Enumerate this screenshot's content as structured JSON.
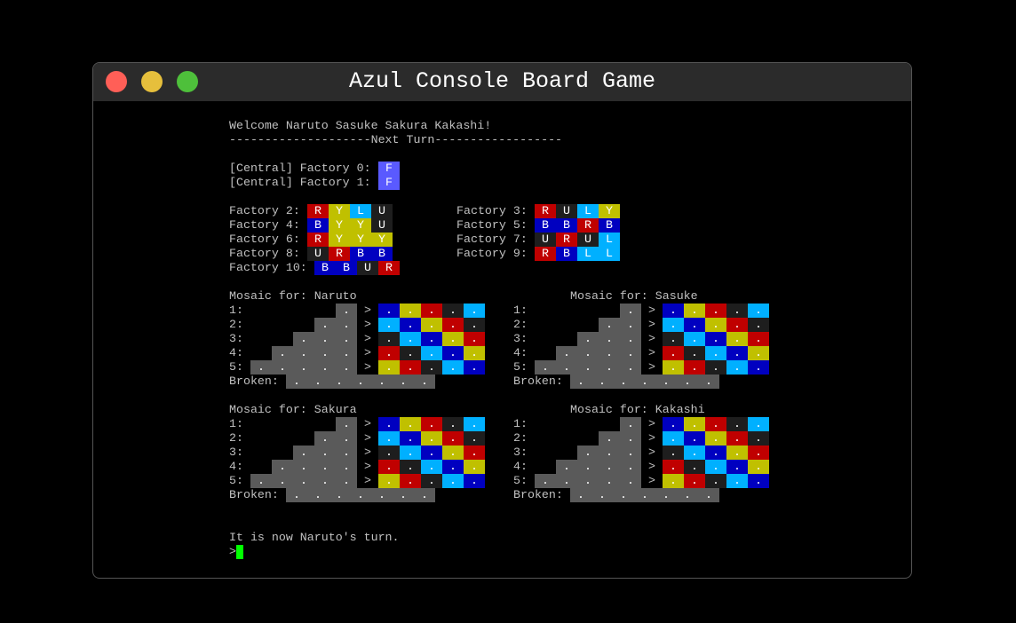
{
  "window": {
    "title": "Azul Console Board Game"
  },
  "colors": {
    "R": "#c00000",
    "Y": "#c0c000",
    "L": "#00b0ff",
    "U": "#1e1e1e",
    "B": "#0000c0",
    "F": "#5a5aff",
    "slot": "#5a5a5a",
    "cursor": "#00ff00"
  },
  "welcome": "Welcome Naruto Sasuke Sakura Kakashi!",
  "separator": "--------------------Next Turn------------------",
  "central": [
    {
      "label": "[Central] Factory 0: ",
      "tiles": [
        "F"
      ]
    },
    {
      "label": "[Central] Factory 1: ",
      "tiles": [
        "F"
      ]
    }
  ],
  "factories_left": [
    {
      "label": "Factory 2: ",
      "tiles": [
        "R",
        "Y",
        "L",
        "U"
      ]
    },
    {
      "label": "Factory 4: ",
      "tiles": [
        "B",
        "Y",
        "Y",
        "U"
      ]
    },
    {
      "label": "Factory 6: ",
      "tiles": [
        "R",
        "Y",
        "Y",
        "Y"
      ]
    },
    {
      "label": "Factory 8: ",
      "tiles": [
        "U",
        "R",
        "B",
        "B"
      ]
    },
    {
      "label": "Factory 10: ",
      "tiles": [
        "B",
        "B",
        "U",
        "R"
      ]
    }
  ],
  "factories_right": [
    {
      "label": "Factory 3: ",
      "tiles": [
        "R",
        "U",
        "L",
        "Y"
      ]
    },
    {
      "label": "Factory 5: ",
      "tiles": [
        "B",
        "B",
        "R",
        "B"
      ]
    },
    {
      "label": "Factory 7: ",
      "tiles": [
        "U",
        "R",
        "U",
        "L"
      ]
    },
    {
      "label": "Factory 9: ",
      "tiles": [
        "R",
        "B",
        "L",
        "L"
      ]
    }
  ],
  "mosaics": [
    {
      "title": "Mosaic for: Naruto"
    },
    {
      "title": "Mosaic for: Sasuke"
    },
    {
      "title": "Mosaic for: Sakura"
    },
    {
      "title": "Mosaic for: Kakashi"
    }
  ],
  "row_labels": [
    "1:",
    "2:",
    "3:",
    "4:",
    "5:"
  ],
  "arrow": ">",
  "empty_mark": ".",
  "broken_label": "Broken:",
  "broken_slots": 7,
  "wall_pattern": [
    [
      "B",
      "Y",
      "R",
      "U",
      "L"
    ],
    [
      "L",
      "B",
      "Y",
      "R",
      "U"
    ],
    [
      "U",
      "L",
      "B",
      "Y",
      "R"
    ],
    [
      "R",
      "U",
      "L",
      "B",
      "Y"
    ],
    [
      "Y",
      "R",
      "U",
      "L",
      "B"
    ]
  ],
  "status": "It is now Naruto's turn.",
  "prompt": ">"
}
